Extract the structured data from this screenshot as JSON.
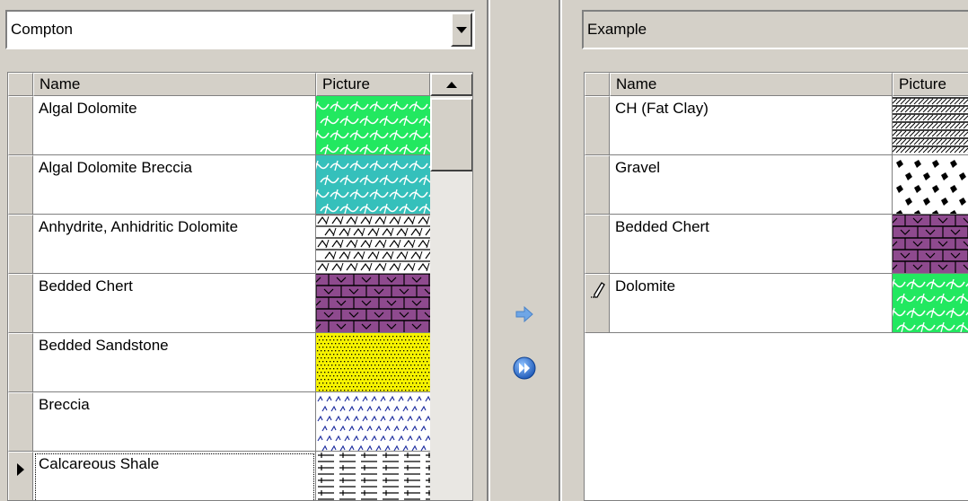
{
  "left": {
    "dropdown_value": "Compton",
    "columns": [
      "Name",
      "Picture"
    ],
    "rows": [
      {
        "name": "Algal Dolomite",
        "pattern": "algal-green"
      },
      {
        "name": "Algal Dolomite Breccia",
        "pattern": "algal-teal"
      },
      {
        "name": "Anhydrite, Anhidritic Dolomite",
        "pattern": "anhydrite"
      },
      {
        "name": "Bedded Chert",
        "pattern": "chert"
      },
      {
        "name": "Bedded Sandstone",
        "pattern": "sandstone"
      },
      {
        "name": "Breccia",
        "pattern": "breccia"
      },
      {
        "name": "Calcareous Shale",
        "pattern": "shale",
        "current": true
      }
    ]
  },
  "right": {
    "field_value": "Example",
    "columns": [
      "Name",
      "Picture"
    ],
    "rows": [
      {
        "name": "CH (Fat Clay)",
        "pattern": "fatclay"
      },
      {
        "name": "Gravel",
        "pattern": "gravel"
      },
      {
        "name": "Bedded Chert",
        "pattern": "chert"
      },
      {
        "name": "Dolomite",
        "pattern": "algal-green",
        "editing": true
      }
    ]
  },
  "icons": {
    "add": "arrow-right-icon",
    "add_all": "fast-forward-icon",
    "current_row": "row-pointer-icon",
    "editing_row": "pencil-icon"
  },
  "colors": {
    "algal_green": "#22e860",
    "algal_teal": "#35c0bb",
    "chert_purple": "#8e4a8e",
    "sandstone_yellow": "#f7f300",
    "breccia_blue": "#2030a0",
    "arrow_blue": "#6fa6e6",
    "ff_blue": "#2a6fd0"
  }
}
